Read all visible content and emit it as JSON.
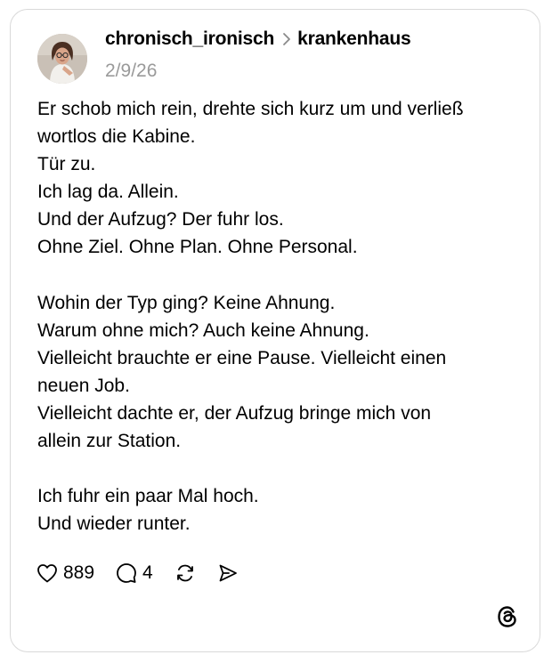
{
  "post": {
    "username": "chronisch_ironisch",
    "channel": "krankenhaus",
    "date": "2/9/26",
    "lines": [
      "Er schob mich rein, drehte sich kurz um und verließ",
      "wortlos die Kabine.",
      "Tür zu.",
      "Ich lag da. Allein.",
      "Und der Aufzug? Der fuhr los.",
      "Ohne Ziel. Ohne Plan. Ohne Personal.",
      "",
      "Wohin der Typ ging? Keine Ahnung.",
      "Warum ohne mich? Auch keine Ahnung.",
      "Vielleicht brauchte er eine Pause. Vielleicht einen",
      "neuen Job.",
      "Vielleicht dachte er, der Aufzug bringe mich von",
      "allein zur Station.",
      "",
      "Ich fuhr ein paar Mal hoch.",
      "Und wieder runter."
    ]
  },
  "actions": {
    "like": {
      "icon": "heart-icon",
      "count": "889"
    },
    "reply": {
      "icon": "comment-icon",
      "count": "4"
    },
    "repost": {
      "icon": "repost-icon"
    },
    "share": {
      "icon": "send-icon"
    }
  },
  "brand": {
    "icon": "threads-logo-icon"
  },
  "colors": {
    "text": "#000000",
    "secondary_text": "#9a9a9a",
    "card_border": "#d9d9d9",
    "background": "#ffffff"
  }
}
